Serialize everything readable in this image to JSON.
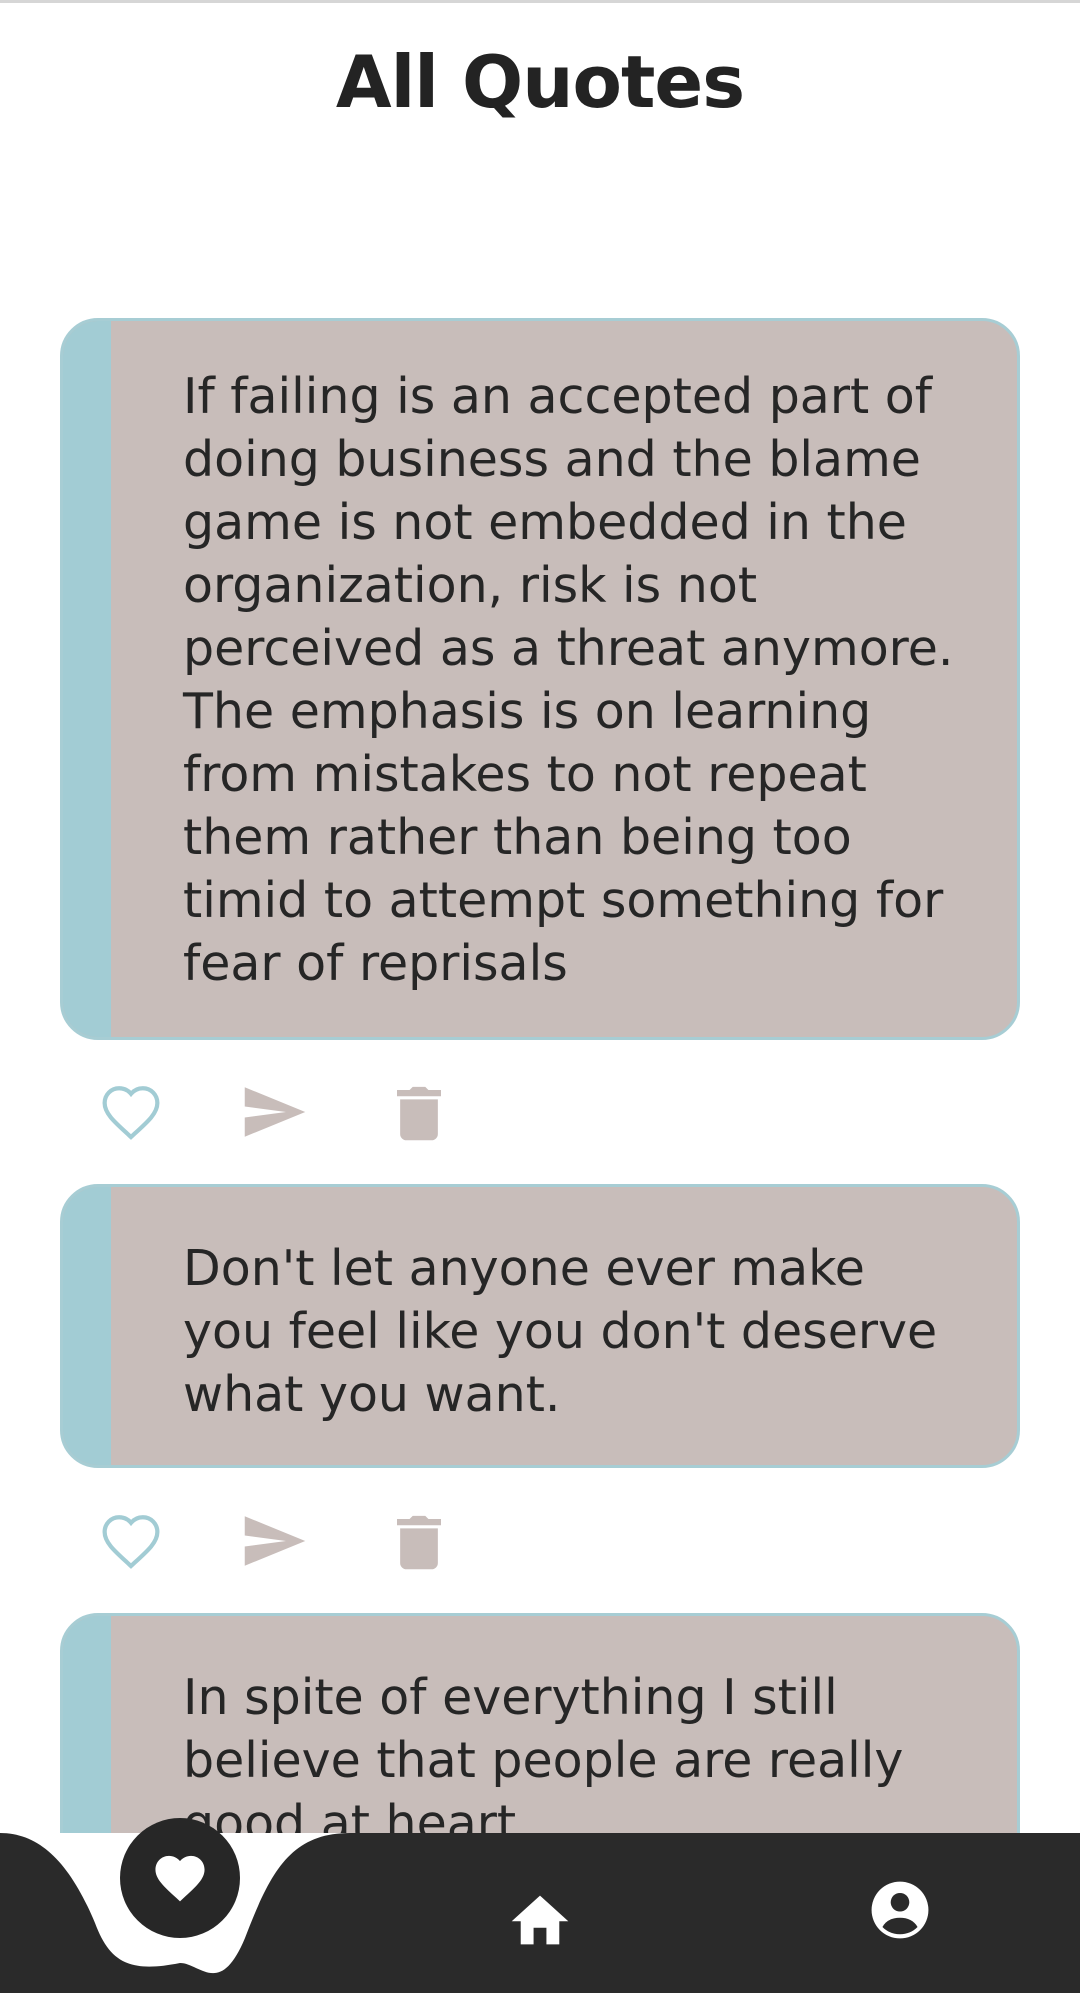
{
  "header": {
    "title": "All Quotes"
  },
  "quotes": [
    {
      "text": "If failing is an accepted part of doing business and the blame game is not embedded in the organization, risk is not perceived as a threat anymore. The emphasis is on learning from mistakes to not repeat them rather than being too timid to attempt something for fear of reprisals"
    },
    {
      "text": "Don't let anyone ever make you feel like you don't deserve what you want."
    },
    {
      "text": "In spite of everything I still believe that people are really good at heart"
    }
  ],
  "actions": {
    "icons": [
      "heart-outline-icon",
      "send-icon",
      "trash-icon"
    ]
  },
  "bottom_nav": {
    "items": [
      "favorites",
      "home",
      "profile"
    ],
    "active": "favorites"
  },
  "colors": {
    "card_bg": "#c8bdba",
    "card_accent": "#a2ccd4",
    "like_icon": "#a2ccd4",
    "action_icon": "#c8bdba",
    "nav_bg": "#2a2a2a"
  }
}
